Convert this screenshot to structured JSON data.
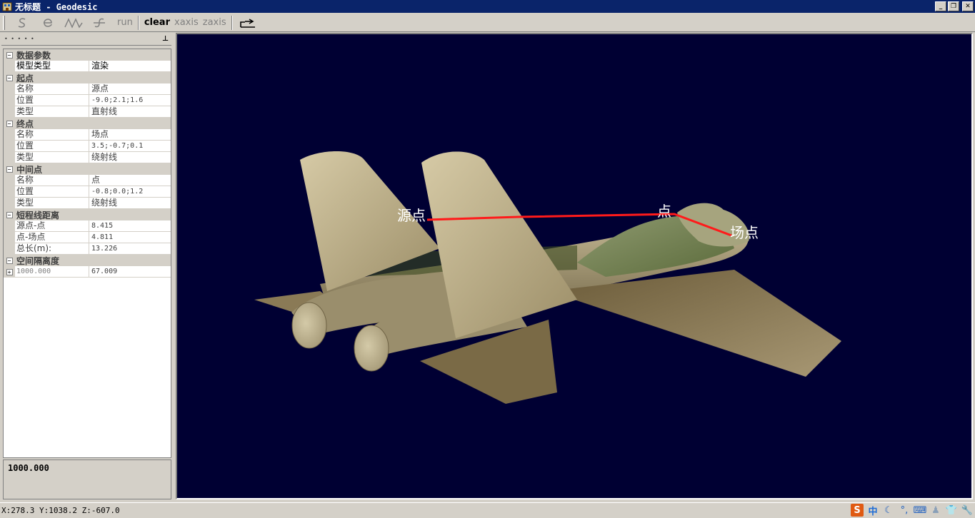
{
  "window": {
    "title": "无标题 - Geodesic"
  },
  "toolbar": {
    "tools": [
      {
        "icon": "s-curve-icon",
        "glyph": "S",
        "enabled": false
      },
      {
        "icon": "e-curve-icon",
        "glyph": "e",
        "enabled": false
      },
      {
        "icon": "zigzag-icon",
        "glyph": "/\\/\\",
        "enabled": false
      },
      {
        "icon": "f-curve-icon",
        "glyph": "f",
        "enabled": false
      }
    ],
    "run_label": "run",
    "clear_label": "clear",
    "xaxis_label": "xaxis",
    "zaxis_label": "zaxis",
    "export_icon": "export-icon"
  },
  "properties": {
    "cat_data": "数据参数",
    "model_type": {
      "name": "模型类型",
      "value": "渲染"
    },
    "cat_start": "起点",
    "start": {
      "name": {
        "name": "名称",
        "value": "源点"
      },
      "position": {
        "name": "位置",
        "value": "-9.0;2.1;1.6"
      },
      "type": {
        "name": "类型",
        "value": "直射线"
      }
    },
    "cat_end": "终点",
    "end": {
      "name": {
        "name": "名称",
        "value": "场点"
      },
      "position": {
        "name": "位置",
        "value": "3.5;-0.7;0.1"
      },
      "type": {
        "name": "类型",
        "value": "绕射线"
      }
    },
    "cat_mid": "中间点",
    "mid": {
      "name": {
        "name": "名称",
        "value": "点"
      },
      "position": {
        "name": "位置",
        "value": "-0.8;0.0;1.2"
      },
      "type": {
        "name": "类型",
        "value": "绕射线"
      }
    },
    "cat_dist": "短程线距离",
    "dist": {
      "src_mid": {
        "name": "源点-点",
        "value": "8.415"
      },
      "mid_field": {
        "name": "点-场点",
        "value": "4.811"
      },
      "total": {
        "name": "总长(m):",
        "value": "13.226"
      }
    },
    "cat_space": "空间隔离度",
    "space": {
      "name": "1000.000",
      "value": "67.009"
    }
  },
  "description": "1000.000",
  "viewport": {
    "labels": {
      "source": "源点",
      "mid": "点",
      "field": "场点"
    },
    "background_color": "#000033",
    "path_color": "#ff1a1a"
  },
  "status": {
    "coords": "X:278.3 Y:1038.2 Z:-607.0",
    "tray_icons": [
      "sogou-s-icon",
      "chinese-mode-icon",
      "moon-icon",
      "punctuation-icon",
      "keyboard-icon",
      "user-icon",
      "skin-icon",
      "tools-icon"
    ],
    "tray_zh": "中"
  }
}
